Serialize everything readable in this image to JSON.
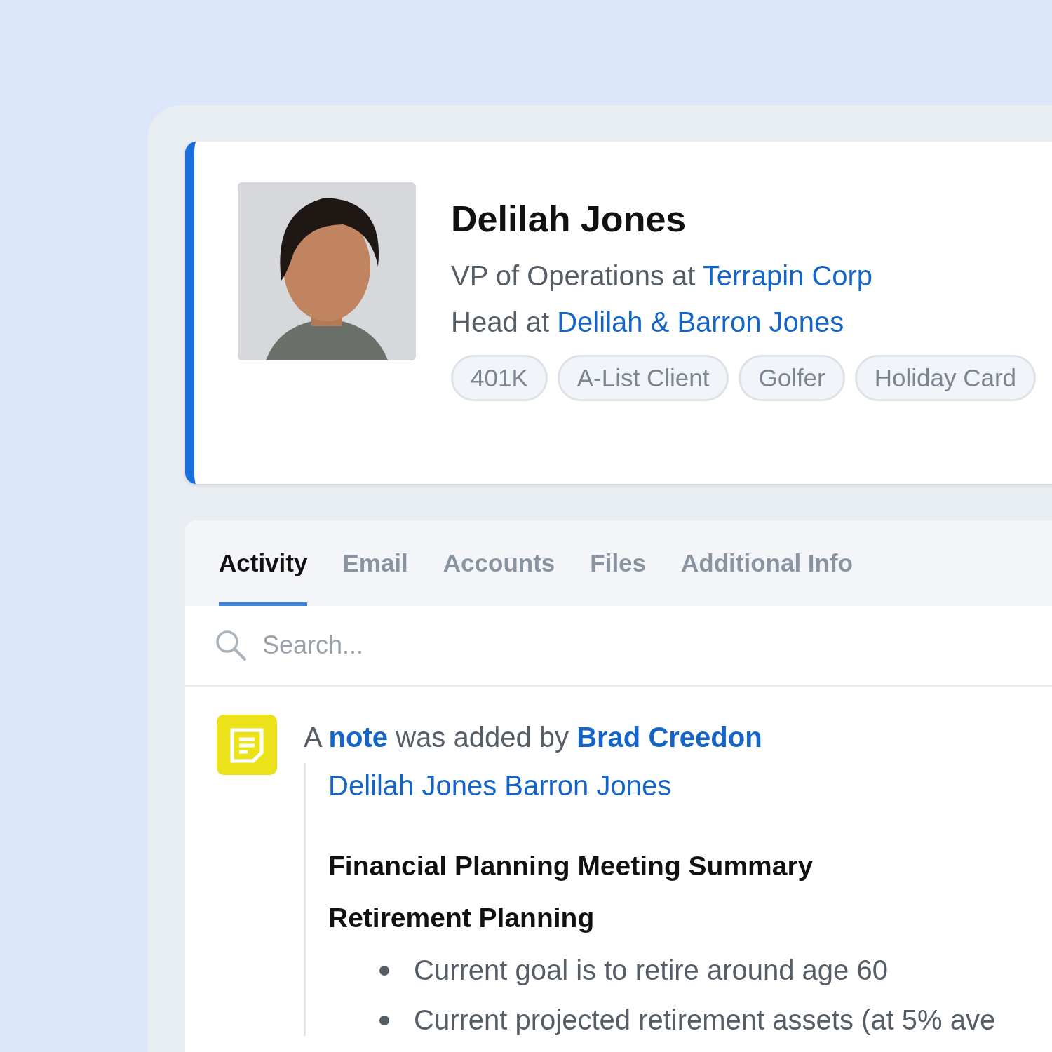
{
  "profile": {
    "name": "Delilah Jones",
    "roles": [
      {
        "text": "VP of Operations at",
        "link": "Terrapin Corp"
      },
      {
        "text": "Head at",
        "link": "Delilah & Barron Jones"
      }
    ],
    "tags": [
      "401K",
      "A-List Client",
      "Golfer",
      "Holiday Card"
    ]
  },
  "tabs": [
    {
      "label": "Activity",
      "selected": true
    },
    {
      "label": "Email",
      "selected": false
    },
    {
      "label": "Accounts",
      "selected": false
    },
    {
      "label": "Files",
      "selected": false
    },
    {
      "label": "Additional Info",
      "selected": false
    }
  ],
  "search": {
    "placeholder": "Search..."
  },
  "activity": [
    {
      "kind": "note",
      "prefix": "A",
      "object_link": "note",
      "middle": "was added by",
      "author": "Brad Creedon",
      "contacts": "Delilah Jones Barron Jones",
      "headings": [
        "Financial Planning Meeting Summary",
        "Retirement Planning"
      ],
      "bullets": [
        "Current goal is to retire around age 60",
        "Current projected retirement assets (at 5% ave"
      ]
    }
  ]
}
